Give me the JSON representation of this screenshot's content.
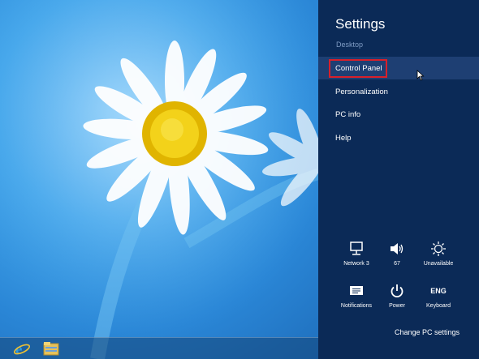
{
  "charm": {
    "title": "Settings",
    "subtitle": "Desktop",
    "items": [
      {
        "label": "Control Panel"
      },
      {
        "label": "Personalization"
      },
      {
        "label": "PC info"
      },
      {
        "label": "Help"
      }
    ],
    "quick": [
      {
        "icon": "network-icon",
        "label": "Network  3"
      },
      {
        "icon": "volume-icon",
        "label": "67"
      },
      {
        "icon": "brightness-icon",
        "label": "Unavailable"
      },
      {
        "icon": "notifications-icon",
        "label": "Notifications"
      },
      {
        "icon": "power-icon",
        "label": "Power"
      },
      {
        "icon": "keyboard-icon",
        "label": "Keyboard",
        "glyph": "ENG"
      }
    ],
    "change_settings": "Change PC settings"
  },
  "taskbar": {
    "icons": [
      "internet-explorer-icon",
      "file-explorer-icon"
    ]
  },
  "colors": {
    "charm_bg": "#0b2a57",
    "active_item": "#1e3f73",
    "highlight": "#d8202a",
    "subtitle": "#7f9cc4"
  }
}
